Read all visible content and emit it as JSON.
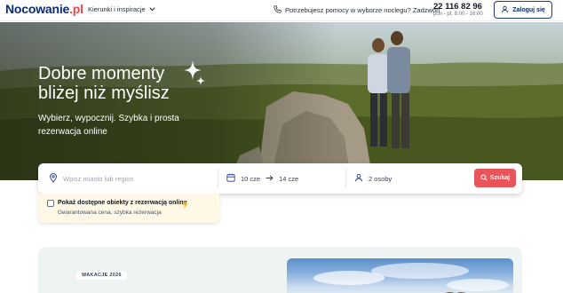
{
  "header": {
    "logo_main": "Nocowanie",
    "logo_tld": ".pl",
    "nav_dropdown": "Kierunki i inspiracje",
    "help_text": "Potrzebujesz pomocy w wyborze noclegu? Zadzwoń",
    "phone": "22 116 82 96",
    "hours": "pon - pt. 8:00 - 16:00",
    "login_label": "Zaloguj się"
  },
  "hero": {
    "title_line1": "Dobre momenty",
    "title_line2": "bliżej niż myślisz",
    "subtitle": "Wybierz, wypocznij. Szybka i prosta rezerwacja online"
  },
  "search": {
    "location_placeholder": "Wpisz miasto lub region",
    "date_from": "10 cze",
    "date_to": "14 cze",
    "guests": "2 osoby",
    "submit_label": "Szukaj"
  },
  "availability": {
    "checkbox_label": "Pokaż dostępne obiekty z rezerwacją online",
    "subtext": "Gwarantowana cena, szybka rezerwacja",
    "checked": false
  },
  "promo": {
    "badge": "WAKACJE 2026"
  },
  "colors": {
    "brand_navy": "#0b2a6f",
    "accent_red": "#e8545a",
    "availability_bg": "#fff8e6"
  }
}
